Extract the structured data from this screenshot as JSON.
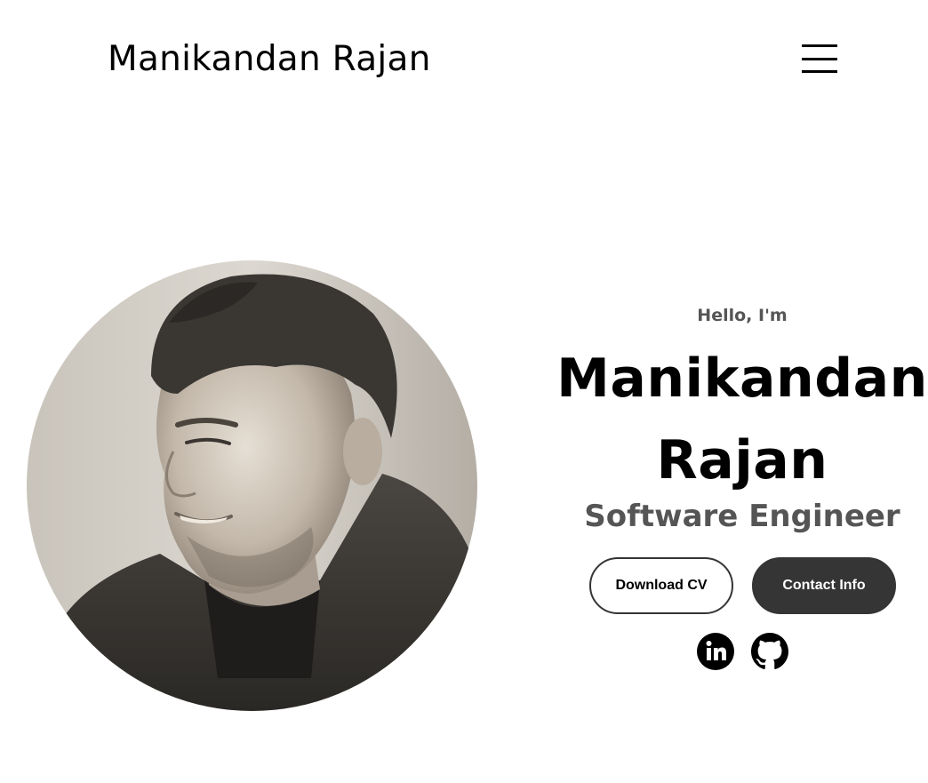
{
  "header": {
    "logo_text": "Manikandan Rajan",
    "menu_icon": "hamburger-menu-icon"
  },
  "profile": {
    "image_description_icon": "profile-photo"
  },
  "intro": {
    "greeting": "Hello, I'm",
    "name_line1": "Manikandan",
    "name_line2": "Rajan",
    "title": "Software Engineer"
  },
  "buttons": {
    "download_cv": "Download CV",
    "contact_info": "Contact Info"
  },
  "social": {
    "linkedin_icon": "linkedin-icon",
    "github_icon": "github-icon"
  },
  "colors": {
    "text_primary": "#000000",
    "text_secondary": "#555555",
    "button_dark": "#353535",
    "background": "#ffffff"
  }
}
